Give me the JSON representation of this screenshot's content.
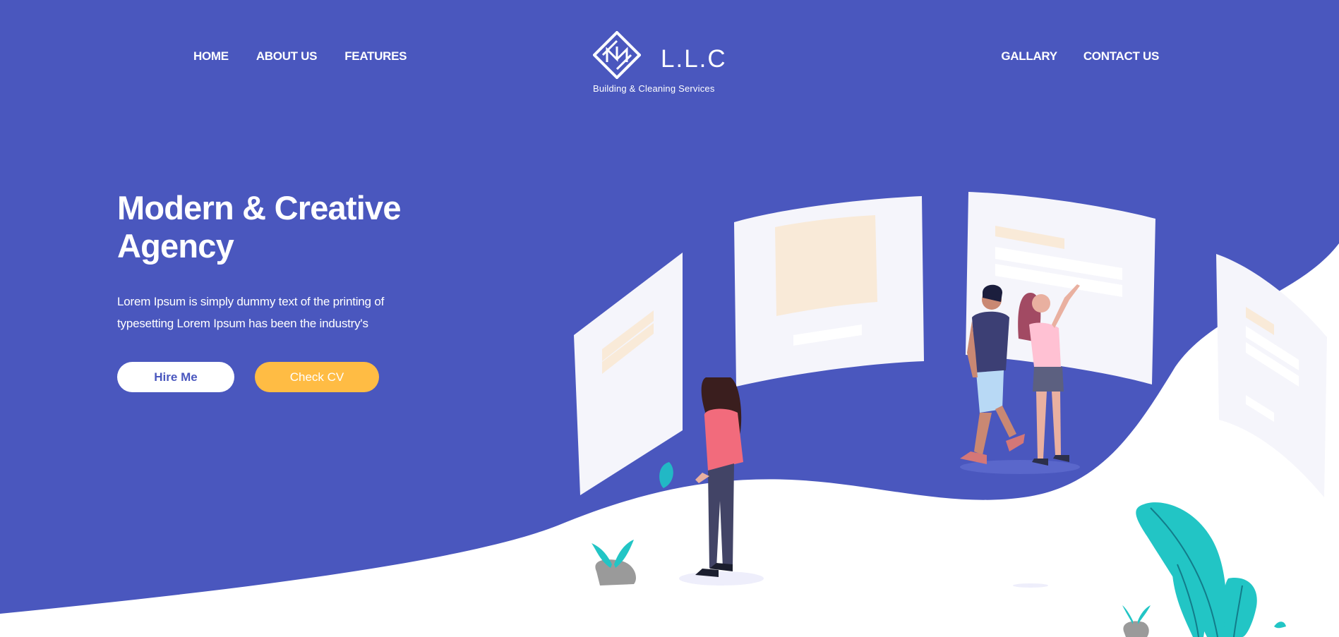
{
  "nav": {
    "left": [
      "HOME",
      "ABOUT US",
      "FEATURES"
    ],
    "right": [
      "GALLARY",
      "CONTACT US"
    ]
  },
  "logo": {
    "name": "L.L.C",
    "tagline": "Building & Cleaning Services"
  },
  "hero": {
    "title": "Modern & Creative Agency",
    "description": "Lorem Ipsum is simply dummy text of the printing of typesetting Lorem Ipsum has been the industry's",
    "hire_label": "Hire Me",
    "cv_label": "Check CV"
  },
  "colors": {
    "primary": "#4a57be",
    "accent": "#ffbc44",
    "teal": "#22c5c5",
    "white": "#ffffff"
  },
  "icons": [
    "diamond-logo-icon",
    "leaf-icon",
    "plant-icon",
    "rock-icon"
  ]
}
